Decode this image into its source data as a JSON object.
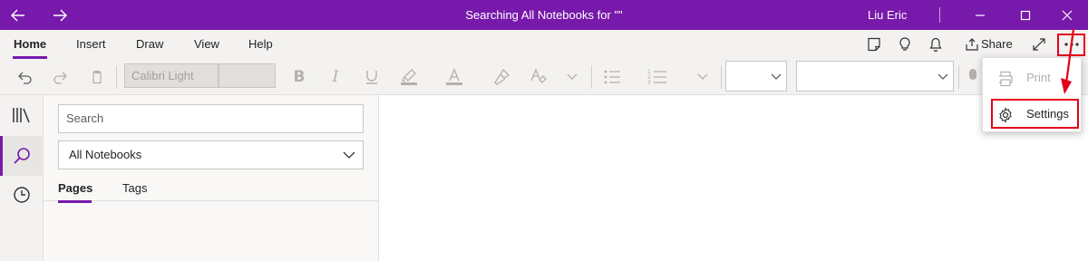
{
  "window": {
    "title": "Searching All Notebooks for \"\"",
    "user": "Liu Eric"
  },
  "ribbon_tabs": [
    "Home",
    "Insert",
    "Draw",
    "View",
    "Help"
  ],
  "ribbon_actions": {
    "share_label": "Share"
  },
  "toolbar": {
    "font_name": "Calibri Light",
    "font_size": ""
  },
  "left_nav": {
    "items": [
      "notebooks-icon",
      "search-icon",
      "recent-icon"
    ],
    "active": "search-icon"
  },
  "search_panel": {
    "search_placeholder": "Search",
    "scope": "All Notebooks",
    "tabs": [
      "Pages",
      "Tags"
    ],
    "active_tab": "Pages"
  },
  "overflow_menu": {
    "items": [
      {
        "label": "Print",
        "icon": "printer-icon",
        "enabled": false
      },
      {
        "label": "Settings",
        "icon": "gear-icon",
        "enabled": true
      }
    ]
  },
  "colors": {
    "accent": "#7719aa",
    "highlight": "#e4001b"
  }
}
